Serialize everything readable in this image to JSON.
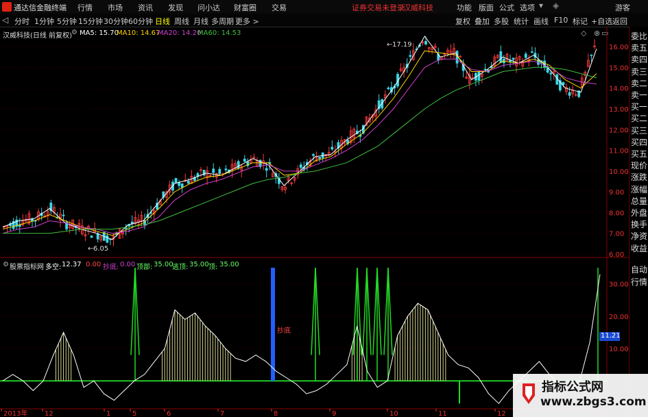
{
  "titlebar": {
    "app_name": "通达信金融终端",
    "menu": [
      "行情",
      "市场",
      "资讯",
      "发现",
      "问小达",
      "财富圈",
      "交易"
    ],
    "warning": "证券交易未登录",
    "warning_stock": "汉威科技",
    "right_menu": [
      "功能",
      "版面",
      "公式",
      "选项"
    ],
    "guest": "游客"
  },
  "toolbar": {
    "periods": [
      "分时",
      "1分钟",
      "5分钟",
      "15分钟",
      "30分钟",
      "60分钟",
      "日线",
      "周线",
      "月线",
      "多周期",
      "更多 >"
    ],
    "active_period": "日线",
    "right_tools": [
      "复权",
      "叠加",
      "多股",
      "统计",
      "画线",
      "F10",
      "标记",
      "+自选",
      "返回"
    ]
  },
  "main": {
    "stock_title": "汉威科技(日线 前复权)",
    "ma": [
      {
        "label": "MA5: 15.70",
        "color": "#ffffff"
      },
      {
        "label": "MA10: 14.67",
        "color": "#ffd400"
      },
      {
        "label": "MA20: 14.20",
        "color": "#d040d0"
      },
      {
        "label": "MA60: 14.53",
        "color": "#40c040"
      }
    ],
    "high_label": "17.19",
    "low_label": "6.05"
  },
  "indicator": {
    "title": "股票指标网",
    "duokong_label": "多空:",
    "duokong_value": "12.37",
    "v1": "0.00",
    "dd_label": "抄底:",
    "dd_value": "0.00",
    "top_label": "顶部:",
    "top_value": "35.00",
    "escape_label": "逃顶:",
    "escape_value": "35.00",
    "z_label": "顶:",
    "z_value": "35.00",
    "bottom_text": "抄底",
    "current_value": "11.21"
  },
  "right_panel": {
    "items": [
      "委比",
      "卖五",
      "卖四",
      "卖三",
      "卖二",
      "卖一",
      "买一",
      "买二",
      "买三",
      "买四",
      "买五",
      "现价",
      "涨跌",
      "涨幅",
      "总量",
      "外盘",
      "换手",
      "净资",
      "收益"
    ],
    "bottom_items": [
      "自动",
      "行情"
    ]
  },
  "chart_data": [
    {
      "type": "line",
      "title": "汉威科技(日线 前复权)",
      "ylim": [
        6.0,
        16.5
      ],
      "yticks": [
        "16.00",
        "15.00",
        "14.00",
        "13.00",
        "12.00",
        "11.00",
        "10.00",
        "9.00",
        "8.00",
        "7.00",
        "6.00"
      ],
      "x_labels": [
        "2013年",
        "12",
        "1",
        "5",
        "6",
        "7",
        "8",
        "9",
        "10",
        "11",
        "12"
      ],
      "series": [
        {
          "name": "MA5",
          "color": "#ffffff",
          "values": [
            7.3,
            7.6,
            7.7,
            8.2,
            7.5,
            7.2,
            7.0,
            6.7,
            7.4,
            7.6,
            8.5,
            9.4,
            9.6,
            9.9,
            9.8,
            10.2,
            10.6,
            10.3,
            9.3,
            10.0,
            10.7,
            10.8,
            11.5,
            12.0,
            13.0,
            14.0,
            15.2,
            16.5,
            15.5,
            15.7,
            14.4,
            14.9,
            15.5,
            15.2,
            15.6,
            14.9,
            14.0,
            13.8,
            15.9
          ]
        },
        {
          "name": "MA10",
          "color": "#ffd400",
          "values": [
            7.2,
            7.4,
            7.6,
            7.9,
            7.6,
            7.3,
            7.1,
            6.9,
            7.2,
            7.5,
            8.2,
            9.0,
            9.4,
            9.7,
            9.8,
            10.1,
            10.4,
            10.4,
            9.8,
            9.9,
            10.5,
            10.7,
            11.3,
            11.8,
            12.6,
            13.5,
            14.6,
            15.8,
            15.7,
            15.6,
            14.8,
            14.8,
            15.3,
            15.2,
            15.4,
            15.1,
            14.4,
            14.0,
            14.7
          ]
        },
        {
          "name": "MA20",
          "color": "#d040d0",
          "values": [
            7.0,
            7.2,
            7.3,
            7.6,
            7.5,
            7.3,
            7.2,
            7.0,
            7.1,
            7.3,
            7.8,
            8.6,
            9.1,
            9.4,
            9.6,
            9.9,
            10.2,
            10.3,
            10.0,
            10.0,
            10.3,
            10.6,
            11.0,
            11.5,
            12.2,
            13.0,
            14.0,
            15.0,
            15.4,
            15.4,
            14.9,
            14.8,
            15.1,
            15.2,
            15.3,
            15.0,
            14.5,
            14.3,
            14.2
          ]
        },
        {
          "name": "MA60",
          "color": "#40c040",
          "values": [
            7.0,
            7.0,
            7.0,
            7.0,
            7.1,
            7.2,
            7.2,
            7.2,
            7.3,
            7.4,
            7.6,
            7.9,
            8.2,
            8.5,
            8.8,
            9.1,
            9.4,
            9.6,
            9.7,
            9.9,
            10.0,
            10.2,
            10.4,
            10.8,
            11.2,
            11.8,
            12.4,
            13.0,
            13.5,
            13.9,
            14.2,
            14.5,
            14.8,
            14.9,
            15.0,
            15.0,
            14.9,
            14.7,
            14.5
          ]
        }
      ]
    },
    {
      "type": "line",
      "title": "股票指标网",
      "ylim": [
        -8,
        35
      ],
      "yticks": [
        "30.00",
        "20.00",
        "10.00"
      ],
      "series": [
        {
          "name": "多空",
          "color": "#ffffff",
          "values": [
            0,
            2,
            0,
            -3,
            0,
            8,
            15,
            8,
            -2,
            0,
            -4,
            -6,
            -3,
            0,
            2,
            6,
            10,
            22,
            19,
            21,
            17,
            14,
            10,
            7,
            6,
            8,
            6,
            3,
            1,
            -1,
            -4,
            -3,
            -1,
            2,
            5,
            17,
            3,
            -2,
            0,
            14,
            20,
            24,
            22,
            15,
            8,
            5,
            4,
            1,
            -4,
            -7,
            -3,
            0,
            3,
            6,
            2,
            -1,
            -3,
            0,
            12,
            33
          ]
        }
      ]
    }
  ]
}
